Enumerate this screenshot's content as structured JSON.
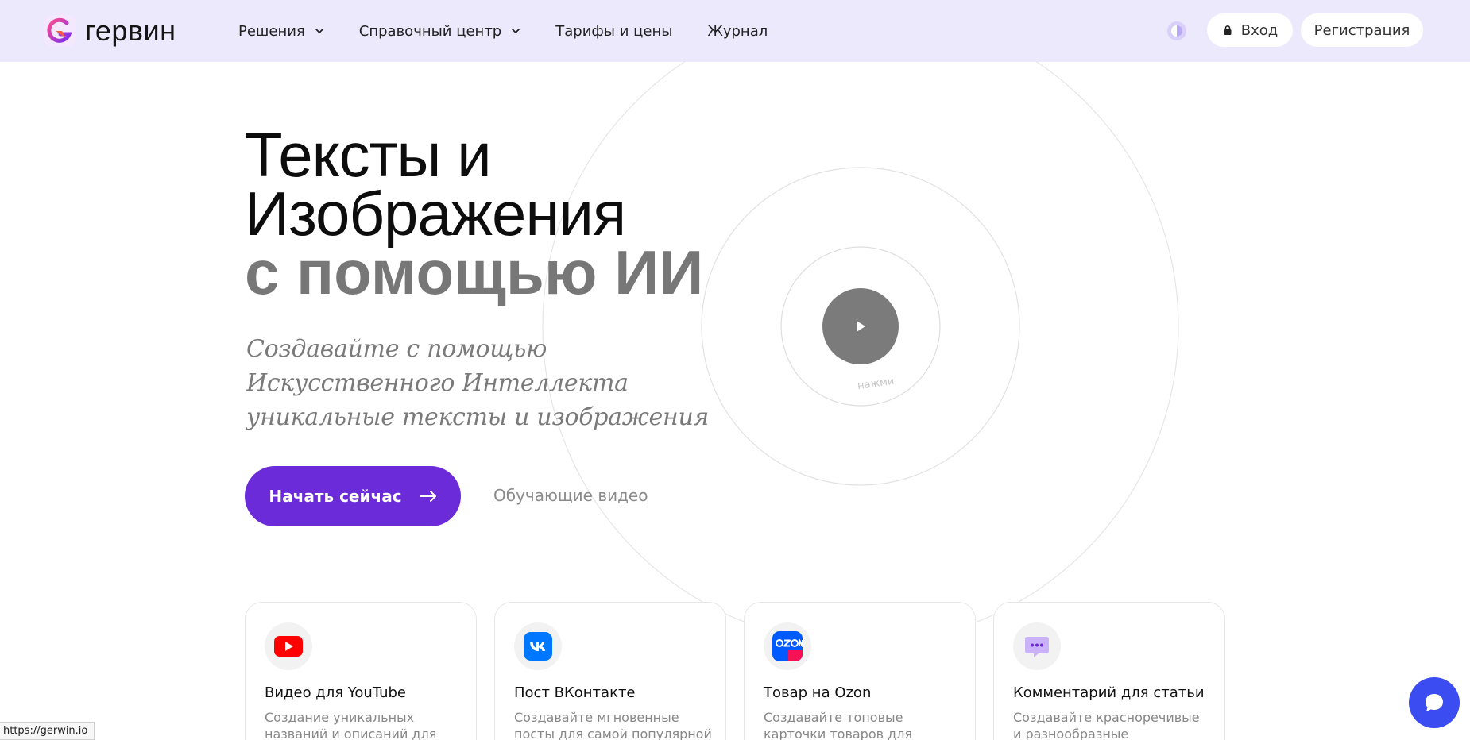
{
  "header": {
    "logo_text": "гервин",
    "nav": [
      {
        "label": "Решения",
        "dropdown": true
      },
      {
        "label": "Справочный центр",
        "dropdown": true
      },
      {
        "label": "Тарифы и цены",
        "dropdown": false
      },
      {
        "label": "Журнал",
        "dropdown": false
      }
    ],
    "login_label": "Вход",
    "register_label": "Регистрация"
  },
  "hero": {
    "title_line1": "Тексты и",
    "title_line2": "Изображения",
    "title_line3": "с помощью ИИ",
    "subtitle": "Создавайте с помощью Искусственного Интеллекта уникальные тексты и изображения",
    "cta_label": "Начать сейчас",
    "video_link_label": "Обучающие видео",
    "play_hint": "нажми"
  },
  "cards": [
    {
      "icon": "youtube-icon",
      "title": "Видео для YouTube",
      "description": "Создание уникальных названий и описаний для"
    },
    {
      "icon": "vk-icon",
      "title": "Пост ВКонтакте",
      "description": "Создавайте мгновенные посты для самой популярной"
    },
    {
      "icon": "ozon-icon",
      "title": "Товар на Ozon",
      "description": "Создавайте топовые карточки товаров для размещения на"
    },
    {
      "icon": "comment-icon",
      "title": "Комментарий для статьи",
      "description": "Создавайте красноречивые и разнообразные комментарии"
    }
  ],
  "status_url": "https://gerwin.io",
  "colors": {
    "header_bg": "#ede9fd",
    "accent": "#6c2bd9",
    "chat": "#3b4cf0",
    "youtube": "#ff0000",
    "vk": "#0077ff",
    "ozon": "#005bff"
  }
}
